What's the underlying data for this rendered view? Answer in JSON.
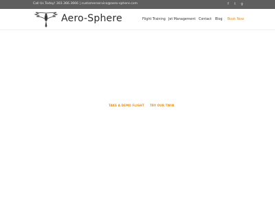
{
  "topbar": {
    "contact_text": "Call Us Today! 303.366.3666 | customerservice@aero-sphere.com",
    "social_icons": [
      "facebook-icon",
      "twitter-icon",
      "google-plus-icon"
    ],
    "background": "#5f5f5f"
  },
  "header": {
    "brand": "Aero-Sphere",
    "nav": [
      {
        "label": "Flight Training"
      },
      {
        "label": "Jet Management"
      },
      {
        "label": "Contact"
      },
      {
        "label": "Blog"
      },
      {
        "label": "Book Now"
      }
    ],
    "accent_color": "#e38a16"
  },
  "hero": {
    "primary_link": "TAKE A DEMO FLIGHT",
    "secondary_link": "TRY OUR TWIN"
  }
}
